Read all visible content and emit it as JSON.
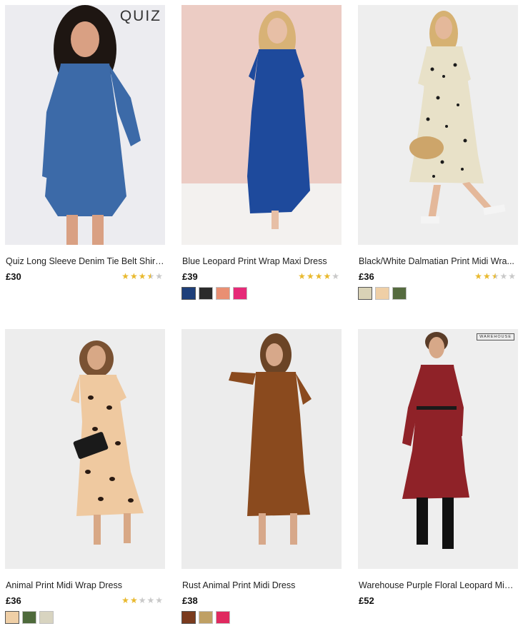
{
  "products": [
    {
      "title": "Quiz Long Sleeve Denim Tie Belt Shirt ...",
      "price": "£30",
      "rating": 3.5,
      "brand_logo": "QUIZ",
      "swatches": [],
      "colors": {
        "bg": "#ececf0",
        "dress": "#3c6aa8",
        "hair": "#1e1612",
        "skin": "#d9a083"
      }
    },
    {
      "title": "Blue Leopard Print Wrap Maxi Dress",
      "price": "£39",
      "rating": 4,
      "brand_logo": "",
      "swatches": [
        "#1e3f7a",
        "#2b2b2b",
        "#e98f73",
        "#e62a78"
      ],
      "colors": {
        "bg": "#ecccc4",
        "dress": "#1e4a9c",
        "hair": "#d8b276",
        "skin": "#e7bfa6"
      }
    },
    {
      "title": "Black/White Dalmatian Print Midi Wra...",
      "price": "£36",
      "rating": 2.5,
      "brand_logo": "",
      "swatches": [
        "#d9d2b6",
        "#efcfa6",
        "#556b3f"
      ],
      "colors": {
        "bg": "#eeeeee",
        "dress": "#e8e1c8",
        "hair": "#d6b172",
        "skin": "#e4b89a"
      }
    },
    {
      "title": "Animal Print Midi Wrap Dress",
      "price": "£36",
      "rating": 2,
      "brand_logo": "",
      "swatches": [
        "#efcfa6",
        "#4e6a3b",
        "#d8d4c0"
      ],
      "colors": {
        "bg": "#ededed",
        "dress": "#efc9a0",
        "hair": "#7a5233",
        "skin": "#d8a886"
      }
    },
    {
      "title": "Rust Animal Print Midi Dress",
      "price": "£38",
      "rating": null,
      "brand_logo": "",
      "swatches": [
        "#7a3b1e",
        "#bfa064",
        "#e0295f"
      ],
      "colors": {
        "bg": "#ececec",
        "dress": "#8a4a1e",
        "hair": "#6b4426",
        "skin": "#d7a88a"
      }
    },
    {
      "title": "Warehouse Purple Floral Leopard Midi ...",
      "price": "£52",
      "rating": null,
      "brand_logo": "WAREHOUSE",
      "swatches": [],
      "colors": {
        "bg": "#eeeeee",
        "dress": "#8f2228",
        "hair": "#5a3c28",
        "skin": "#d7a888"
      }
    }
  ]
}
